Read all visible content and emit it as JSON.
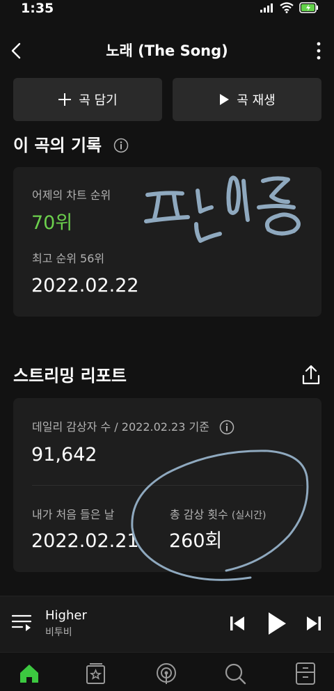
{
  "status_bar": {
    "time": "1:35"
  },
  "header": {
    "title": "노래 (The Song)"
  },
  "actions": {
    "add_label": "곡 담기",
    "play_label": "곡 재생"
  },
  "record": {
    "heading": "이 곡의 기록",
    "yesterday_label": "어제의 차트 순위",
    "yesterday_rank": "70위",
    "best_label": "최고 순위 56위",
    "best_date": "2022.02.22",
    "handwriting": "팍인증"
  },
  "report": {
    "heading": "스트리밍 리포트",
    "daily_label": "데일리 감상자 수 / 2022.02.23 기준",
    "daily_value": "91,642",
    "first_listen_label": "내가 처음 들은 날",
    "first_listen_value": "2022.02.21",
    "total_label": "총 감상 횟수",
    "total_sub": "(실시간)",
    "total_value": "260회"
  },
  "player": {
    "song": "Higher",
    "artist": "비투비"
  },
  "colors": {
    "accent": "#6cd04d",
    "background": "#121212",
    "card": "#1e1e1e",
    "ink": "#8fa9bf"
  }
}
